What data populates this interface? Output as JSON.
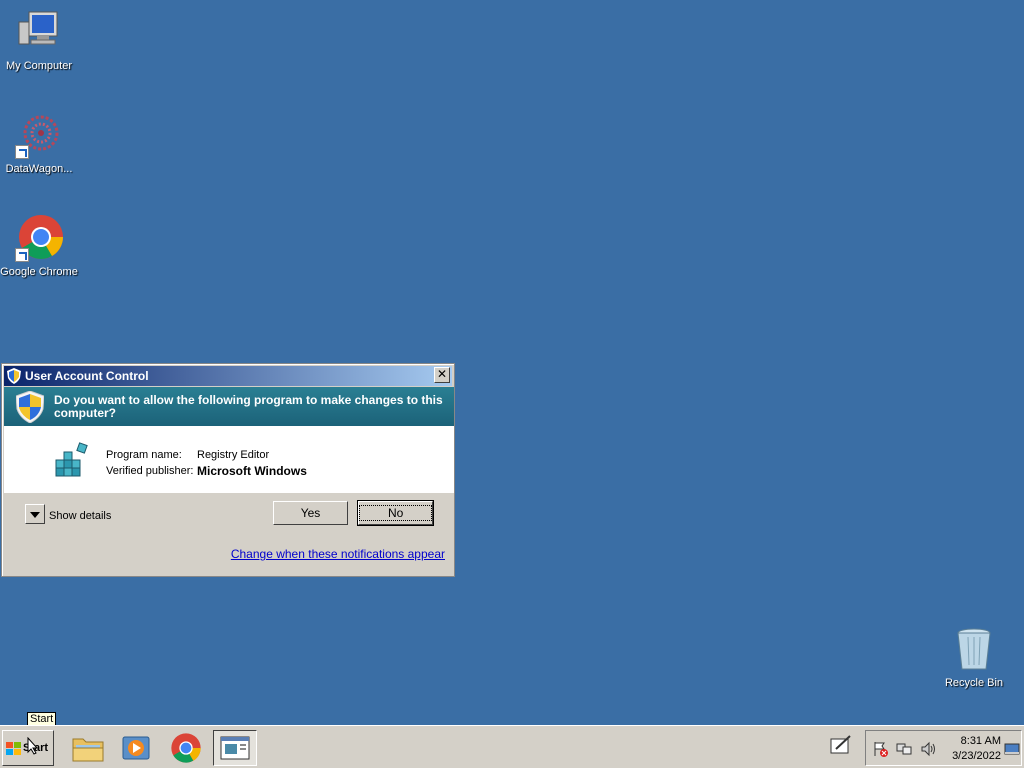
{
  "desktop": {
    "icons": [
      {
        "label": "My Computer",
        "icon": "computer-icon"
      },
      {
        "label": "DataWagon...",
        "icon": "datawagon-icon"
      },
      {
        "label": "Google Chrome",
        "icon": "chrome-icon"
      },
      {
        "label": "Recycle Bin",
        "icon": "recycle-bin-icon"
      }
    ]
  },
  "dialog": {
    "title": "User Account Control",
    "question": "Do you want to allow the following program to make changes to this computer?",
    "program_label": "Program name:",
    "program_value": "Registry Editor",
    "publisher_label": "Verified publisher:",
    "publisher_value": "Microsoft Windows",
    "show_details": "Show details",
    "yes_label": "Yes",
    "no_label": "No",
    "change_link": "Change when these notifications appear",
    "close_glyph": "✕"
  },
  "taskbar": {
    "start_label": "Start",
    "tooltip": "Start",
    "pinned": [
      "file-explorer-icon",
      "media-player-icon",
      "chrome-icon",
      "uac-window-icon"
    ],
    "clock_time": "8:31 AM",
    "clock_date": "3/23/2022"
  },
  "colors": {
    "desktop": "#3a6ea5",
    "title_gradient_start": "#0a246a",
    "banner": "#1c6279",
    "link": "#0000cc"
  }
}
